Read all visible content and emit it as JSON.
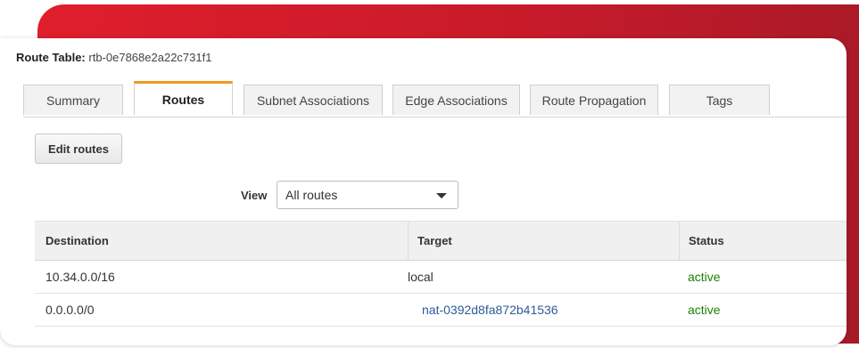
{
  "route_table": {
    "label": "Route Table:",
    "id": "rtb-0e7868e2a22c731f1"
  },
  "tabs": [
    {
      "label": "Summary",
      "active": false
    },
    {
      "label": "Routes",
      "active": true
    },
    {
      "label": "Subnet Associations",
      "active": false
    },
    {
      "label": "Edge Associations",
      "active": false
    },
    {
      "label": "Route Propagation",
      "active": false
    },
    {
      "label": "Tags",
      "active": false
    }
  ],
  "actions": {
    "edit_routes": "Edit routes"
  },
  "view": {
    "label": "View",
    "selected": "All routes"
  },
  "table": {
    "headers": {
      "destination": "Destination",
      "target": "Target",
      "status": "Status"
    },
    "rows": [
      {
        "destination": "10.34.0.0/16",
        "target": "local",
        "status": "active"
      },
      {
        "destination": "0.0.0.0/0",
        "target": "nat-0392d8fa872b41536",
        "status": "active"
      }
    ]
  },
  "colors": {
    "accent_tab": "#f29a1a",
    "status_active": "#1d8102",
    "link": "#2e5b9a",
    "background_red": "#d21d2b"
  }
}
